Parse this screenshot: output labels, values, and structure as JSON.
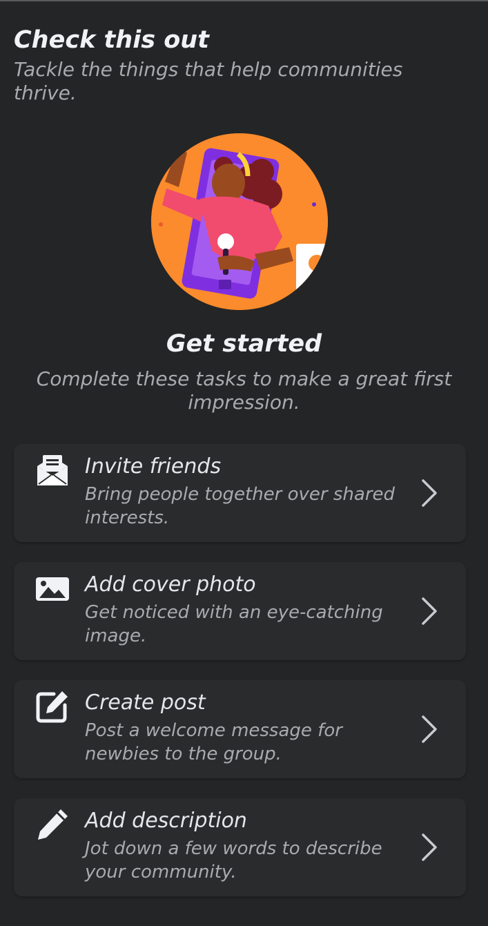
{
  "header": {
    "title": "Check this out",
    "subtitle": "Tackle the things that help communities thrive."
  },
  "hero": {
    "illustration": "person-with-microphone-in-phone"
  },
  "get_started": {
    "title": "Get started",
    "subtitle": "Complete these tasks to make a great first impression."
  },
  "tasks": [
    {
      "icon": "envelope-icon",
      "title": "Invite friends",
      "description": "Bring people together over shared interests."
    },
    {
      "icon": "image-icon",
      "title": "Add cover photo",
      "description": "Get noticed with an eye-catching image."
    },
    {
      "icon": "edit-square-icon",
      "title": "Create post",
      "description": "Post a welcome message for newbies to the group."
    },
    {
      "icon": "pencil-icon",
      "title": "Add description",
      "description": "Jot down a few words to describe your community."
    }
  ],
  "colors": {
    "background": "#242526",
    "card": "#2a2b2c",
    "primary_text": "#e4e6eb",
    "secondary_text": "#a8abaf",
    "hero_orange": "#fb8b2c",
    "hero_purple": "#8a3ee8"
  }
}
